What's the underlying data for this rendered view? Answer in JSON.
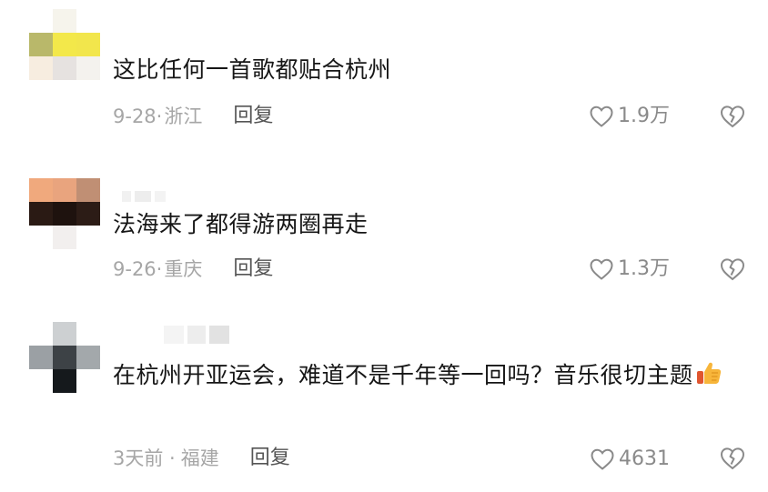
{
  "comments": [
    {
      "text": "这比任何一首歌都贴合杭州",
      "date": "9-28·",
      "location": "浙江",
      "reply_label": "回复",
      "likes": "1.9万"
    },
    {
      "text": "法海来了都得游两圈再走",
      "date": "9-26·",
      "location": "重庆",
      "reply_label": "回复",
      "likes": "1.3万"
    },
    {
      "text": "在杭州开亚运会，难道不是千年等一回吗？音乐很切主题",
      "date": "3天前 ·",
      "location": "福建",
      "reply_label": "回复",
      "likes": "4631"
    }
  ],
  "icons": {
    "like": "heart-outline-icon",
    "dislike": "broken-heart-icon",
    "emoji": "thumbs-up-emoji"
  },
  "colors": {
    "text": "#161616",
    "meta": "#a6a6a6",
    "reply": "#555555",
    "icon": "#8a8a8a"
  }
}
